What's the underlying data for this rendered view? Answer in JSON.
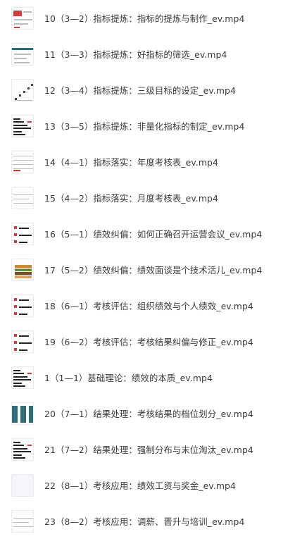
{
  "files": [
    {
      "name": "10（3—2）指标提炼：指标的提炼与制作_ev.mp4",
      "thumb": "slide-colored"
    },
    {
      "name": "11（3—3）指标提炼：好指标的筛选_ev.mp4",
      "thumb": "slide-teal-header"
    },
    {
      "name": "12（3—4）指标提炼：三级目标的设定_ev.mp4",
      "thumb": "slide-diagonal"
    },
    {
      "name": "13（3—5）指标提炼：非量化指标的制定_ev.mp4",
      "thumb": "slide-text-dense"
    },
    {
      "name": "14（4—1）指标落实：年度考核表_ev.mp4",
      "thumb": "slide-table"
    },
    {
      "name": "15（4—2）指标落实：月度考核表_ev.mp4",
      "thumb": "slide-table-light"
    },
    {
      "name": "16（5—1）绩效纠偏：如何正确召开运营会议_ev.mp4",
      "thumb": "slide-dots-red"
    },
    {
      "name": "17（5—2）绩效纠偏：绩效面谈是个技术活儿_ev.mp4",
      "thumb": "slide-burger"
    },
    {
      "name": "18（6—1）考核评估：组织绩效与个人绩效_ev.mp4",
      "thumb": "slide-dots-red"
    },
    {
      "name": "19（6—2）考核评估：考核结果纠偏与修正_ev.mp4",
      "thumb": "slide-dots-red"
    },
    {
      "name": "1（1—1）基础理论：绩效的本质_ev.mp4",
      "thumb": "slide-text-dense"
    },
    {
      "name": "20（7—1）结果处理：考核结果的档位划分_ev.mp4",
      "thumb": "slide-teal-blocks"
    },
    {
      "name": "21（7—2）结果处理：强制分布与末位淘汰_ev.mp4",
      "thumb": "slide-text-dense"
    },
    {
      "name": "22（8—1）考核应用：绩效工资与奖金_ev.mp4",
      "thumb": "slide-blank"
    },
    {
      "name": "23（8—2）考核应用：调薪、晋升与培训_ev.mp4",
      "thumb": "slide-table-light"
    }
  ]
}
